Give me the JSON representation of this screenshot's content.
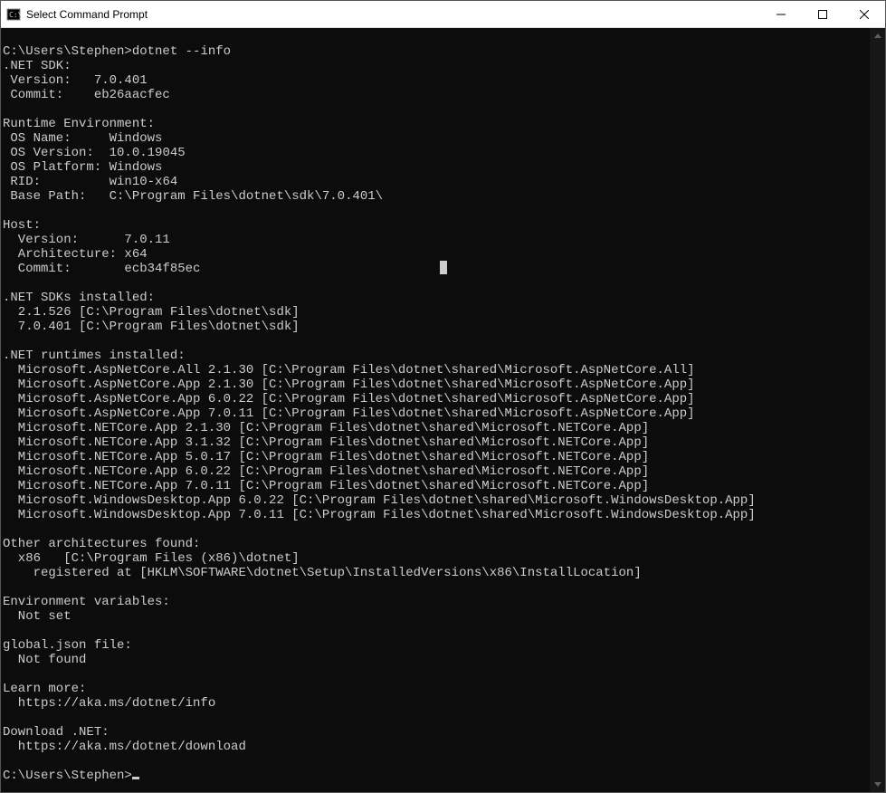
{
  "window": {
    "title": "Select Command Prompt"
  },
  "terminal": {
    "prompt1": "C:\\Users\\Stephen>",
    "cmd1": "dotnet --info",
    "sdk_header": ".NET SDK:",
    "sdk_version_label": " Version:",
    "sdk_version": "   7.0.401",
    "sdk_commit_label": " Commit:",
    "sdk_commit": "    eb26aacfec",
    "runtime_env_header": "Runtime Environment:",
    "os_name_label": " OS Name:",
    "os_name": "     Windows",
    "os_version_label": " OS Version:",
    "os_version": "  10.0.19045",
    "os_platform_label": " OS Platform:",
    "os_platform": " Windows",
    "rid_label": " RID:",
    "rid": "         win10-x64",
    "base_path_label": " Base Path:",
    "base_path": "   C:\\Program Files\\dotnet\\sdk\\7.0.401\\",
    "host_header": "Host:",
    "host_version_label": "  Version:",
    "host_version": "      7.0.11",
    "host_arch_label": "  Architecture:",
    "host_arch": " x64",
    "host_commit_label": "  Commit:",
    "host_commit": "       ecb34f85ec",
    "sdks_installed_header": ".NET SDKs installed:",
    "sdk_installed_1": "  2.1.526 [C:\\Program Files\\dotnet\\sdk]",
    "sdk_installed_2": "  7.0.401 [C:\\Program Files\\dotnet\\sdk]",
    "runtimes_installed_header": ".NET runtimes installed:",
    "rt01": "  Microsoft.AspNetCore.All 2.1.30 [C:\\Program Files\\dotnet\\shared\\Microsoft.AspNetCore.All]",
    "rt02": "  Microsoft.AspNetCore.App 2.1.30 [C:\\Program Files\\dotnet\\shared\\Microsoft.AspNetCore.App]",
    "rt03": "  Microsoft.AspNetCore.App 6.0.22 [C:\\Program Files\\dotnet\\shared\\Microsoft.AspNetCore.App]",
    "rt04": "  Microsoft.AspNetCore.App 7.0.11 [C:\\Program Files\\dotnet\\shared\\Microsoft.AspNetCore.App]",
    "rt05": "  Microsoft.NETCore.App 2.1.30 [C:\\Program Files\\dotnet\\shared\\Microsoft.NETCore.App]",
    "rt06": "  Microsoft.NETCore.App 3.1.32 [C:\\Program Files\\dotnet\\shared\\Microsoft.NETCore.App]",
    "rt07": "  Microsoft.NETCore.App 5.0.17 [C:\\Program Files\\dotnet\\shared\\Microsoft.NETCore.App]",
    "rt08": "  Microsoft.NETCore.App 6.0.22 [C:\\Program Files\\dotnet\\shared\\Microsoft.NETCore.App]",
    "rt09": "  Microsoft.NETCore.App 7.0.11 [C:\\Program Files\\dotnet\\shared\\Microsoft.NETCore.App]",
    "rt10": "  Microsoft.WindowsDesktop.App 6.0.22 [C:\\Program Files\\dotnet\\shared\\Microsoft.WindowsDesktop.App]",
    "rt11": "  Microsoft.WindowsDesktop.App 7.0.11 [C:\\Program Files\\dotnet\\shared\\Microsoft.WindowsDesktop.App]",
    "other_arch_header": "Other architectures found:",
    "other_arch_1": "  x86   [C:\\Program Files (x86)\\dotnet]",
    "other_arch_2": "    registered at [HKLM\\SOFTWARE\\dotnet\\Setup\\InstalledVersions\\x86\\InstallLocation]",
    "env_vars_header": "Environment variables:",
    "env_vars_value": "  Not set",
    "global_json_header": "global.json file:",
    "global_json_value": "  Not found",
    "learn_more_header": "Learn more:",
    "learn_more_url": "  https://aka.ms/dotnet/info",
    "download_header": "Download .NET:",
    "download_url": "  https://aka.ms/dotnet/download",
    "prompt2": "C:\\Users\\Stephen>"
  }
}
